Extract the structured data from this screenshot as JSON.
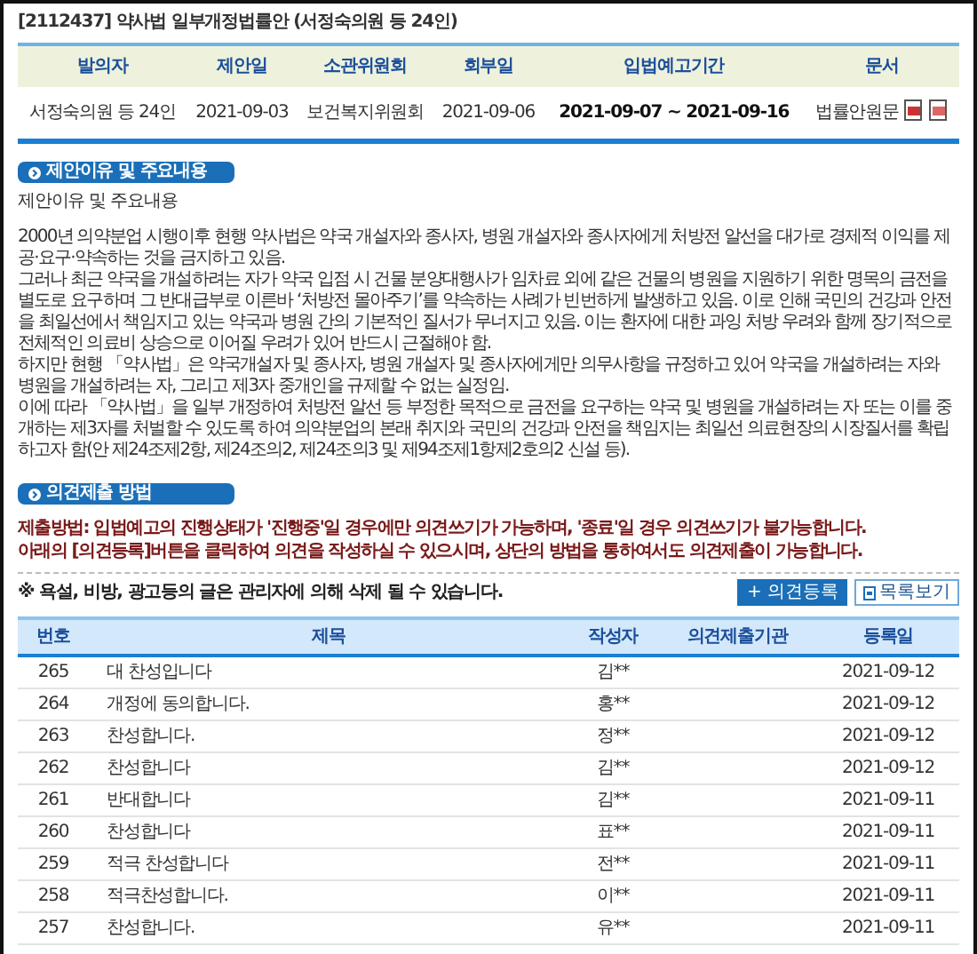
{
  "bill_title": "[2112437] 약사법 일부개정법률안 (서정숙의원 등 24인)",
  "info_table": {
    "columns": [
      "발의자",
      "제안일",
      "소관위원회",
      "회부일",
      "입법예고기간",
      "문서"
    ],
    "row": {
      "proposer": "서정숙의원 등 24인",
      "proposed_date": "2021-09-03",
      "committee": "보건복지위원회",
      "referral_date": "2021-09-06",
      "notice_period": "2021-09-07 ~ 2021-09-16",
      "document": "법률안원문"
    }
  },
  "reason_section": {
    "heading": "제안이유 및 주요내용",
    "subtitle": "제안이유 및 주요내용",
    "paragraphs": [
      "2000년 의약분업 시행이후 현행 약사법은 약국 개설자와 종사자, 병원 개설자와 종사자에게 처방전 알선을 대가로 경제적 이익를 제공·요구·약속하는 것을 금지하고 있음.",
      "그러나 최근 약국을 개설하려는 자가 약국 입점 시 건물 분양대행사가 임차료 외에 같은 건물의 병원을 지원하기 위한 명목의 금전을 별도로 요구하며 그 반대급부로 이른바 ‘처방전 몰아주기’를 약속하는 사례가 빈번하게 발생하고 있음. 이로 인해 국민의 건강과 안전을 최일선에서 책임지고 있는 약국과 병원 간의 기본적인 질서가 무너지고 있음. 이는 환자에 대한 과잉 처방 우려와 함께 장기적으로 전체적인 의료비 상승으로 이어질 우려가 있어 반드시 근절해야 함.",
      "하지만 현행 「약사법」은 약국개설자 및 종사자, 병원 개설자 및 종사자에게만 의무사항을 규정하고 있어 약국을 개설하려는 자와 병원을 개설하려는 자, 그리고 제3자 중개인을 규제할 수 없는 실정임.",
      "이에 따라 「약사법」을 일부 개정하여 처방전 알선 등 부정한 목적으로 금전을 요구하는 약국 및 병원을 개설하려는 자 또는 이를 중개하는 제3자를 처벌할 수 있도록 하여 의약분업의 본래 취지와 국민의 건강과 안전을 책임지는 최일선 의료현장의 시장질서를 확립하고자 함(안 제24조제2항, 제24조의2, 제24조의3 및 제94조제1항제2호의2 신설 등)."
    ]
  },
  "opinion_section": {
    "heading": "의견제출 방법",
    "instructions": [
      "제출방법: 입법예고의 진행상태가 '진행중'일 경우에만 의견쓰기가 가능하며, '종료'일 경우 의견쓰기가 불가능합니다.",
      "아래의 [의견등록]버튼을 클릭하여 의견을 작성하실 수 있으시며, 상단의 방법을 통하여서도 의견제출이 가능합니다."
    ],
    "notice": "※ 욕설, 비방, 광고등의 글은 관리자에 의해 삭제 될 수 있습니다.",
    "buttons": [
      {
        "label": "+ 의견등록",
        "kind": "primary"
      },
      {
        "label": "목록보기",
        "kind": "outline"
      }
    ]
  },
  "comments_table": {
    "columns": [
      "번호",
      "제목",
      "작성자",
      "의견제출기관",
      "등록일"
    ],
    "rows": [
      {
        "number": "265",
        "title": "대 찬성입니다",
        "author": "김**",
        "date": "2021-09-12"
      },
      {
        "number": "264",
        "title": "개정에 동의합니다.",
        "author": "홍**",
        "date": "2021-09-12"
      },
      {
        "number": "263",
        "title": "찬성합니다.",
        "author": "정**",
        "date": "2021-09-12"
      },
      {
        "number": "262",
        "title": "찬성합니다",
        "author": "김**",
        "date": "2021-09-12"
      },
      {
        "number": "261",
        "title": "반대합니다",
        "author": "김**",
        "date": "2021-09-11"
      },
      {
        "number": "260",
        "title": "찬성합니다",
        "author": "표**",
        "date": "2021-09-11"
      },
      {
        "number": "259",
        "title": "적극 찬성합니다",
        "author": "전**",
        "date": "2021-09-11"
      },
      {
        "number": "258",
        "title": "적극찬성합니다.",
        "author": "이**",
        "date": "2021-09-11"
      },
      {
        "number": "257",
        "title": "찬성합니다.",
        "author": "유**",
        "date": "2021-09-11"
      }
    ]
  }
}
